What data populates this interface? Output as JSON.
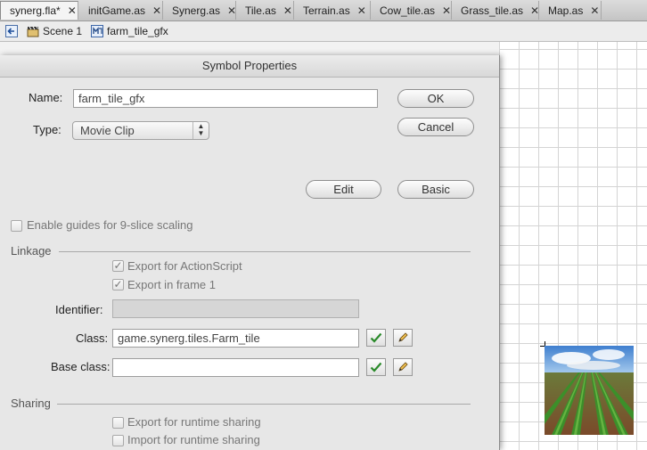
{
  "tabs": [
    {
      "label": "synerg.fla*",
      "active": true,
      "closable": true
    },
    {
      "label": "initGame.as",
      "closable": true
    },
    {
      "label": "Synerg.as",
      "closable": true
    },
    {
      "label": "Tile.as",
      "closable": true
    },
    {
      "label": "Terrain.as",
      "closable": true
    },
    {
      "label": "Cow_tile.as",
      "closable": true
    },
    {
      "label": "Grass_tile.as",
      "closable": true
    },
    {
      "label": "Map.as",
      "closable": true
    }
  ],
  "close_glyph": "✕",
  "breadcrumb": {
    "scene": "Scene 1",
    "symbol": "farm_tile_gfx"
  },
  "dialog": {
    "title": "Symbol Properties",
    "name_label": "Name:",
    "name_value": "farm_tile_gfx",
    "type_label": "Type:",
    "type_value": "Movie Clip",
    "ok_label": "OK",
    "cancel_label": "Cancel",
    "edit_label": "Edit",
    "basic_label": "Basic",
    "guides_label": "Enable guides for 9-slice scaling",
    "guides_checked": false,
    "linkage_title": "Linkage",
    "export_as_label": "Export for ActionScript",
    "export_as_checked": true,
    "export_frame_label": "Export in frame 1",
    "export_frame_checked": true,
    "identifier_label": "Identifier:",
    "identifier_value": "",
    "class_label": "Class:",
    "class_value": "game.synerg.tiles.Farm_tile",
    "base_class_label": "Base class:",
    "base_class_value": "",
    "sharing_title": "Sharing",
    "runtime_export_label": "Export for runtime sharing",
    "runtime_export_checked": false,
    "runtime_import_label": "Import for runtime sharing",
    "runtime_import_checked": false
  },
  "icons": {
    "back": "back-arrow-icon",
    "scene": "clapperboard-icon",
    "movieclip": "movieclip-symbol-icon",
    "validate": "checkmark-icon",
    "edit_class": "pencil-icon"
  },
  "colors": {
    "accent_check": "#2a8a2a",
    "stage_grid": "#d4d4d4"
  }
}
